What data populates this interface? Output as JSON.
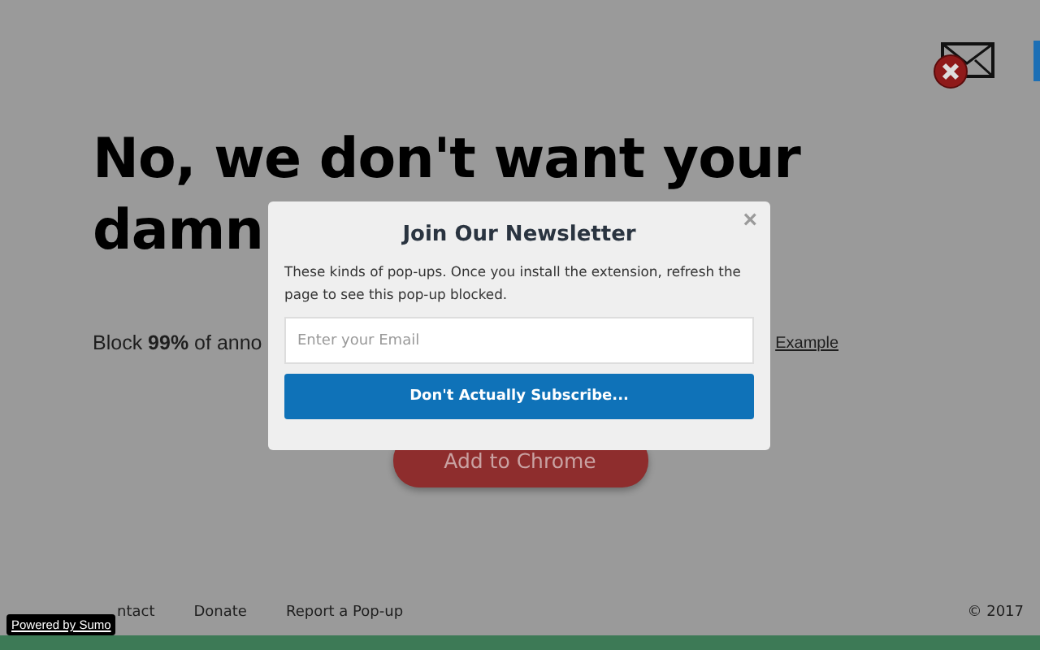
{
  "page": {
    "headline": [
      "No, we don't want your",
      "damn"
    ],
    "subline": {
      "text": "Block **99%** of anno",
      "link": "Example"
    },
    "cta": "Add to Chrome",
    "footer": {
      "links": [
        "ntact",
        "Donate",
        "Report a Pop-up"
      ],
      "copyright": "© 2017"
    },
    "badge": "Powered by Sumo"
  },
  "popup": {
    "title": "Join Our Newsletter",
    "close": "×",
    "message": "These kinds of pop-ups. Once you install the extension, refresh the page to see this pop-up blocked.",
    "email": {
      "placeholder": "Enter your Email"
    },
    "button": "Don't Actually Subscribe..."
  }
}
